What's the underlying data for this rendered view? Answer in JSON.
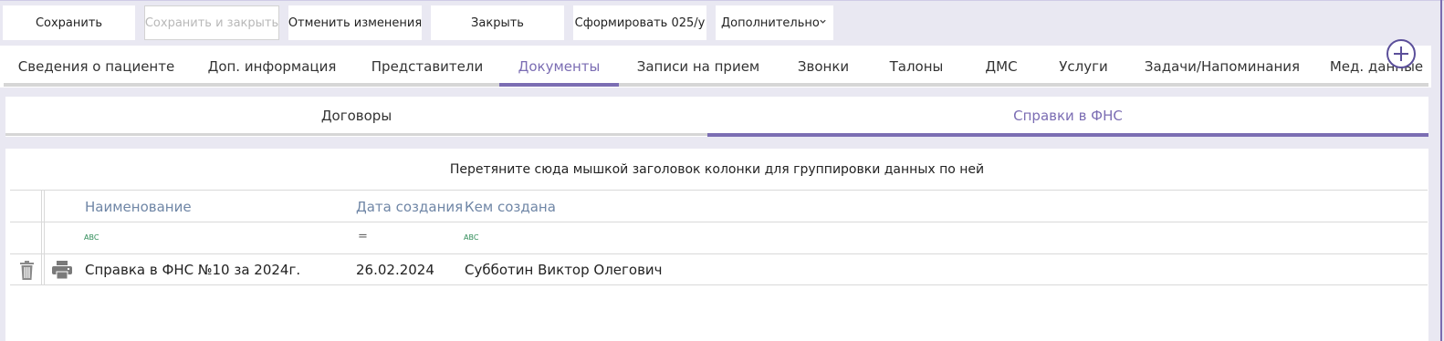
{
  "toolbar": {
    "save_label": "Сохранить",
    "save_close_label": "Сохранить и закрыть",
    "cancel_label": "Отменить изменения",
    "close_label": "Закрыть",
    "form_label": "Сформировать 025/у",
    "more_label": "Дополнительно"
  },
  "tabs": [
    {
      "label": "Сведения о пациенте"
    },
    {
      "label": "Доп. информация"
    },
    {
      "label": "Представители"
    },
    {
      "label": "Документы"
    },
    {
      "label": "Записи на прием"
    },
    {
      "label": "Звонки"
    },
    {
      "label": "Талоны"
    },
    {
      "label": "ДМС"
    },
    {
      "label": "Услуги"
    },
    {
      "label": "Задачи/Напоминания"
    },
    {
      "label": "Мед. данные"
    }
  ],
  "active_tab": "Документы",
  "subtabs": [
    {
      "label": "Договоры"
    },
    {
      "label": "Справки в ФНС"
    }
  ],
  "active_subtab": "Справки в ФНС",
  "grid": {
    "group_hint": "Перетяните сюда мышкой заголовок колонки для группировки данных по ней",
    "columns": [
      "Наименование",
      "Дата создания",
      "Кем создана"
    ],
    "filter_icons": [
      "text-filter-icon",
      "equals-filter-icon",
      "text-filter-icon"
    ],
    "filter_equals": "=",
    "filter_text_glyph": "ABC",
    "rows": [
      {
        "name": "Справка в ФНС №10 за 2024г.",
        "created": "26.02.2024",
        "author": "Субботин Виктор Олегович"
      }
    ]
  },
  "colors": {
    "accent": "#7b6db3",
    "header_text": "#6f86a6",
    "background": "#e9e8f2"
  }
}
